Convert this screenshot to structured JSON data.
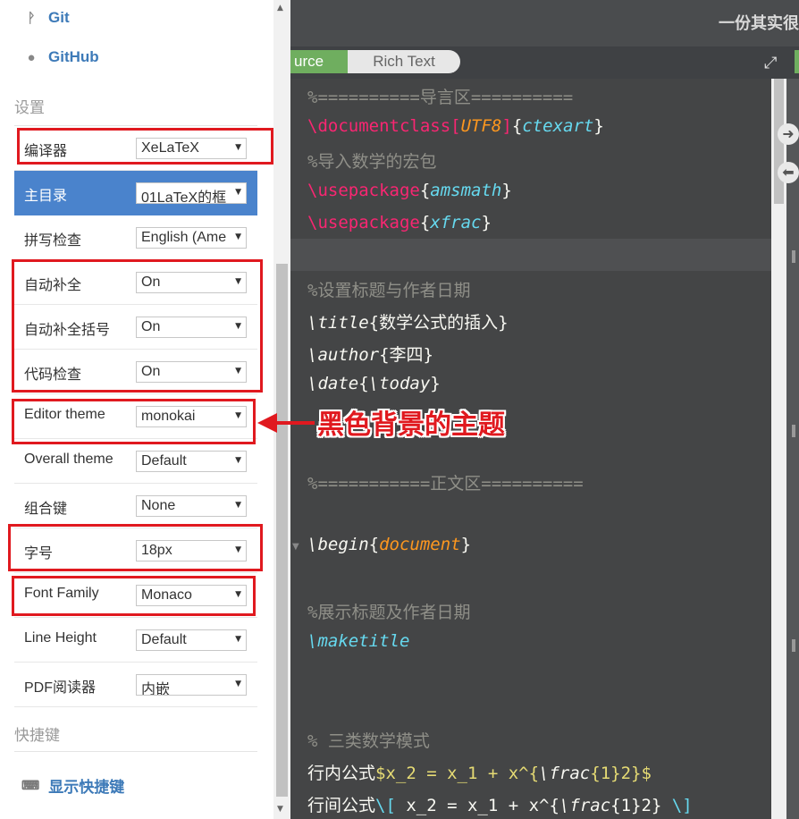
{
  "links": {
    "git": "Git",
    "github": "GitHub"
  },
  "sections": {
    "settings": "设置",
    "shortcuts": "快捷键"
  },
  "settings": [
    {
      "label": "编译器",
      "value": "XeLaTeX"
    },
    {
      "label": "主目录",
      "value": "01LaTeX的框"
    },
    {
      "label": "拼写检查",
      "value": "English (Ame"
    },
    {
      "label": "自动补全",
      "value": "On"
    },
    {
      "label": "自动补全括号",
      "value": "On"
    },
    {
      "label": "代码检查",
      "value": "On"
    },
    {
      "label": "Editor theme",
      "value": "monokai"
    },
    {
      "label": "Overall theme",
      "value": "Default"
    },
    {
      "label": "组合键",
      "value": "None"
    },
    {
      "label": "字号",
      "value": "18px"
    },
    {
      "label": "Font Family",
      "value": "Monaco"
    },
    {
      "label": "Line Height",
      "value": "Default"
    },
    {
      "label": "PDF阅读器",
      "value": "内嵌"
    }
  ],
  "show_shortcuts": "显示快捷键",
  "document_title": "一份其实很",
  "tabs": {
    "source": "urce",
    "rich": "Rich Text"
  },
  "annotation": "黑色背景的主题",
  "code": {
    "l1": "%==========导言区==========",
    "l2_cmd": "\\documentclass",
    "l2_opt": "UTF8",
    "l2_arg": "ctexart",
    "l3": "%导入数学的宏包",
    "l4_cmd": "\\usepackage",
    "l4_arg": "amsmath",
    "l5_cmd": "\\usepackage",
    "l5_arg": "xfrac",
    "l7": "%设置标题与作者日期",
    "l8_cmd": "\\title",
    "l8_arg": "数学公式的插入",
    "l9_cmd": "\\author",
    "l9_arg": "李四",
    "l10_cmd": "\\date",
    "l10_arg": "\\today",
    "l12": "%===========正文区==========",
    "l13_cmd": "\\begin",
    "l13_arg": "document",
    "l14": "%展示标题及作者日期",
    "l15": "\\maketitle",
    "l16": "% 三类数学模式",
    "l17_text": "行内公式",
    "l17_math1": "$x_2 = x_1 + x^{",
    "l17_frac": "\\frac",
    "l17_math2": "{1}2}$",
    "l18_text": "行间公式",
    "l18_open": "\\[",
    "l18_math1": " x_2 = x_1 + x^{",
    "l18_frac": "\\frac",
    "l18_math2": "{1}2} ",
    "l18_close": "\\]"
  }
}
